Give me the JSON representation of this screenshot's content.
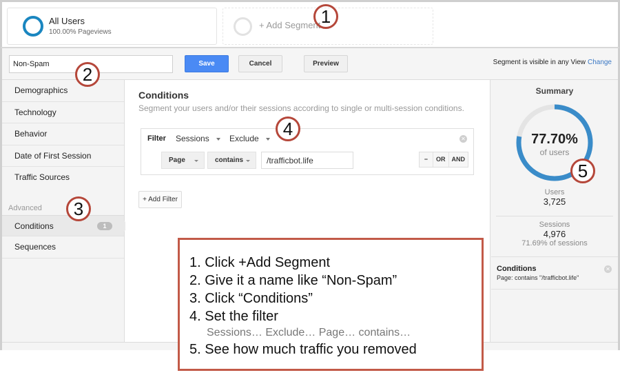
{
  "segments": {
    "all_users": {
      "title": "All Users",
      "subtitle": "100.00% Pageviews",
      "icon": "ring-icon",
      "color": "#1a86c0"
    },
    "add_segment": {
      "label": "+ Add Segment",
      "icon": "ring-icon"
    }
  },
  "toolbar": {
    "segment_name_value": "Non-Spam",
    "save_label": "Save",
    "cancel_label": "Cancel",
    "preview_label": "Preview",
    "visibility_text": "Segment is visible in any View",
    "change_label": "Change"
  },
  "sidebar": {
    "items": [
      {
        "label": "Demographics"
      },
      {
        "label": "Technology"
      },
      {
        "label": "Behavior"
      },
      {
        "label": "Date of First Session"
      },
      {
        "label": "Traffic Sources"
      }
    ],
    "advanced_heading": "Advanced",
    "advanced_items": [
      {
        "label": "Conditions",
        "badge": "1",
        "active": true
      },
      {
        "label": "Sequences"
      }
    ]
  },
  "main": {
    "title": "Conditions",
    "description": "Segment your users and/or their sessions according to single or multi-session conditions.",
    "filter": {
      "label": "Filter",
      "scope": "Sessions",
      "mode": "Exclude",
      "dimension": "Page",
      "operator": "contains",
      "value": "/trafficbot.life",
      "remove_label": "−",
      "or_label": "OR",
      "and_label": "AND"
    },
    "add_filter_label": "+ Add Filter"
  },
  "summary": {
    "title": "Summary",
    "percent_label": "77.70%",
    "percent_value": 77.7,
    "percent_sub": "of users",
    "users_label": "Users",
    "users_value": "3,725",
    "sessions_label": "Sessions",
    "sessions_value": "4,976",
    "sessions_pct": "71.69% of sessions",
    "condition_title": "Conditions",
    "condition_text": "Page: contains \"/trafficbot.life\"",
    "ring_color": "#3a8cc9",
    "ring_track_color": "#e4e4e4"
  },
  "callouts": [
    "1",
    "2",
    "3",
    "4",
    "5"
  ],
  "instructions": {
    "steps": [
      "1. Click +Add Segment",
      "2. Give it a name like “Non-Spam”",
      "3. Click “Conditions”",
      "4. Set the filter",
      "5. See how much traffic you removed"
    ],
    "step4_detail": "Sessions… Exclude… Page… contains…",
    "border_color": "#c25a48"
  }
}
